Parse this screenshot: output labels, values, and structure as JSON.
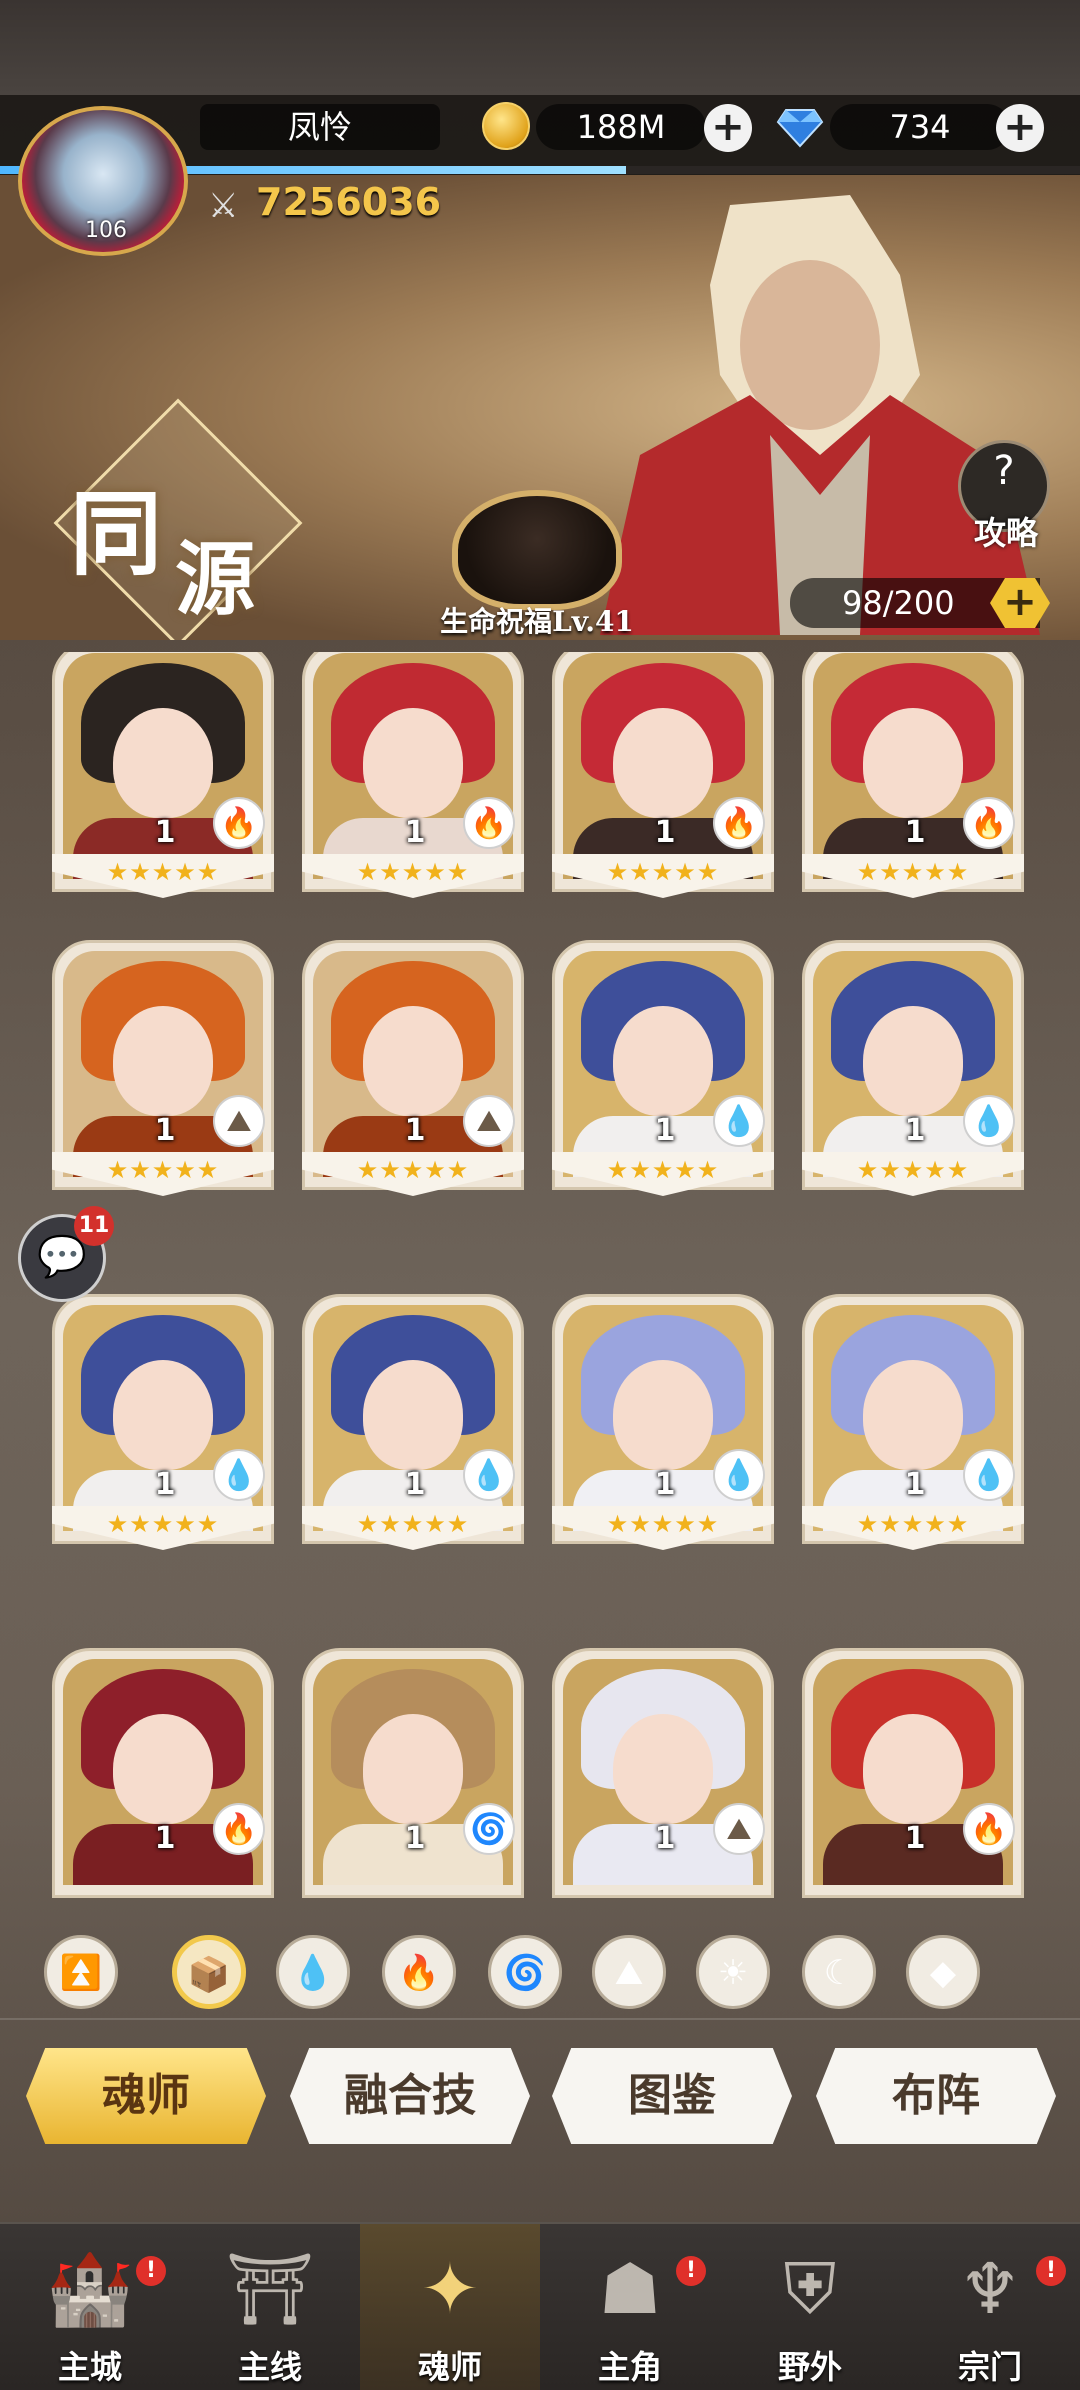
{
  "player": {
    "name": "凤怜",
    "level": "106",
    "power": "7256036",
    "xp_fraction": 0.58
  },
  "resources": {
    "coins": "188M",
    "gems": "734"
  },
  "banner": {
    "title_char1": "同",
    "title_char2": "源",
    "blessing": "生命祝福Lv.41",
    "guide_label": "攻略",
    "capacity": "98/200"
  },
  "cards": [
    {
      "level": "1",
      "element": "fire",
      "stars": "★★★★★",
      "hair": "#2b2420",
      "body": "#8b2a26",
      "bg": "#c9a560"
    },
    {
      "level": "1",
      "element": "fire",
      "stars": "★★★★★",
      "hair": "#c02a32",
      "body": "#e8d8cf",
      "bg": "#c9a560"
    },
    {
      "level": "1",
      "element": "fire",
      "stars": "★★★★★",
      "hair": "#c52a36",
      "body": "#3b2a26",
      "bg": "#c9a560"
    },
    {
      "level": "1",
      "element": "fire",
      "stars": "★★★★★",
      "hair": "#c52a36",
      "body": "#3b2a26",
      "bg": "#c9a560"
    },
    {
      "level": "1",
      "element": "earth",
      "stars": "★★★★★",
      "hair": "#d6641f",
      "body": "#9a3a14",
      "bg": "#d8b98a"
    },
    {
      "level": "1",
      "element": "earth",
      "stars": "★★★★★",
      "hair": "#d6641f",
      "body": "#9a3a14",
      "bg": "#d8b98a"
    },
    {
      "level": "1",
      "element": "water",
      "stars": "★★★★★",
      "hair": "#3e4f9a",
      "body": "#f1efee",
      "bg": "#d7b46b"
    },
    {
      "level": "1",
      "element": "water",
      "stars": "★★★★★",
      "hair": "#3e4f9a",
      "body": "#f1efee",
      "bg": "#d7b46b"
    },
    {
      "level": "1",
      "element": "water",
      "stars": "★★★★★",
      "hair": "#3e4f9a",
      "body": "#f1efee",
      "bg": "#d7b46b"
    },
    {
      "level": "1",
      "element": "water",
      "stars": "★★★★★",
      "hair": "#3e4f9a",
      "body": "#f1efee",
      "bg": "#d7b46b"
    },
    {
      "level": "1",
      "element": "water",
      "stars": "★★★★★",
      "hair": "#9aa4de",
      "body": "#f0f0f4",
      "bg": "#d7b46b"
    },
    {
      "level": "1",
      "element": "water",
      "stars": "★★★★★",
      "hair": "#9aa4de",
      "body": "#f0f0f4",
      "bg": "#d7b46b"
    },
    {
      "level": "1",
      "element": "fire",
      "stars": "",
      "hair": "#8e1f2a",
      "body": "#7a1f22",
      "bg": "#c9a560"
    },
    {
      "level": "1",
      "element": "wind",
      "stars": "",
      "hair": "#b58d5c",
      "body": "#efe3cf",
      "bg": "#c9a560"
    },
    {
      "level": "1",
      "element": "earth",
      "stars": "",
      "hair": "#e7e6ef",
      "body": "#e9e9f2",
      "bg": "#c9a560"
    },
    {
      "level": "1",
      "element": "fire",
      "stars": "",
      "hair": "#c8302a",
      "body": "#5a2a22",
      "bg": "#c9a560"
    }
  ],
  "elements": {
    "fire": {
      "glyph": "🔥",
      "color": "#d9302a"
    },
    "water": {
      "glyph": "💧",
      "color": "#2b7fd6"
    },
    "earth": {
      "glyph": "⛰",
      "color": "#6b5a48"
    },
    "wind": {
      "glyph": "🌀",
      "color": "#2f9a48"
    }
  },
  "chat": {
    "badge": "11"
  },
  "filters": [
    {
      "name": "filter-rank",
      "glyph": "⏫",
      "active": false
    },
    {
      "name": "filter-box",
      "glyph": "📦",
      "active": true
    },
    {
      "name": "filter-water",
      "glyph": "💧",
      "active": false
    },
    {
      "name": "filter-fire",
      "glyph": "🔥",
      "active": false
    },
    {
      "name": "filter-wind",
      "glyph": "🌀",
      "active": false
    },
    {
      "name": "filter-earth",
      "glyph": "⛰",
      "active": false
    },
    {
      "name": "filter-light",
      "glyph": "☀",
      "active": false
    },
    {
      "name": "filter-dark",
      "glyph": "☾",
      "active": false
    },
    {
      "name": "filter-special",
      "glyph": "◆",
      "active": false
    }
  ],
  "tabs": [
    {
      "label": "魂师",
      "active": true
    },
    {
      "label": "融合技",
      "active": false
    },
    {
      "label": "图鉴",
      "active": false
    },
    {
      "label": "布阵",
      "active": false
    }
  ],
  "nav": [
    {
      "label": "主城",
      "icon": "castle-icon",
      "glyph": "🏰",
      "badge": "!",
      "active": false
    },
    {
      "label": "主线",
      "icon": "portal-icon",
      "glyph": "⛩",
      "badge": "",
      "active": false
    },
    {
      "label": "魂师",
      "icon": "crystal-icon",
      "glyph": "✦",
      "badge": "",
      "active": true
    },
    {
      "label": "主角",
      "icon": "hood-icon",
      "glyph": "☗",
      "badge": "!",
      "active": false
    },
    {
      "label": "野外",
      "icon": "shield-sword-icon",
      "glyph": "⛨",
      "badge": "",
      "active": false
    },
    {
      "label": "宗门",
      "icon": "emblem-icon",
      "glyph": "♆",
      "badge": "!",
      "active": false
    }
  ]
}
